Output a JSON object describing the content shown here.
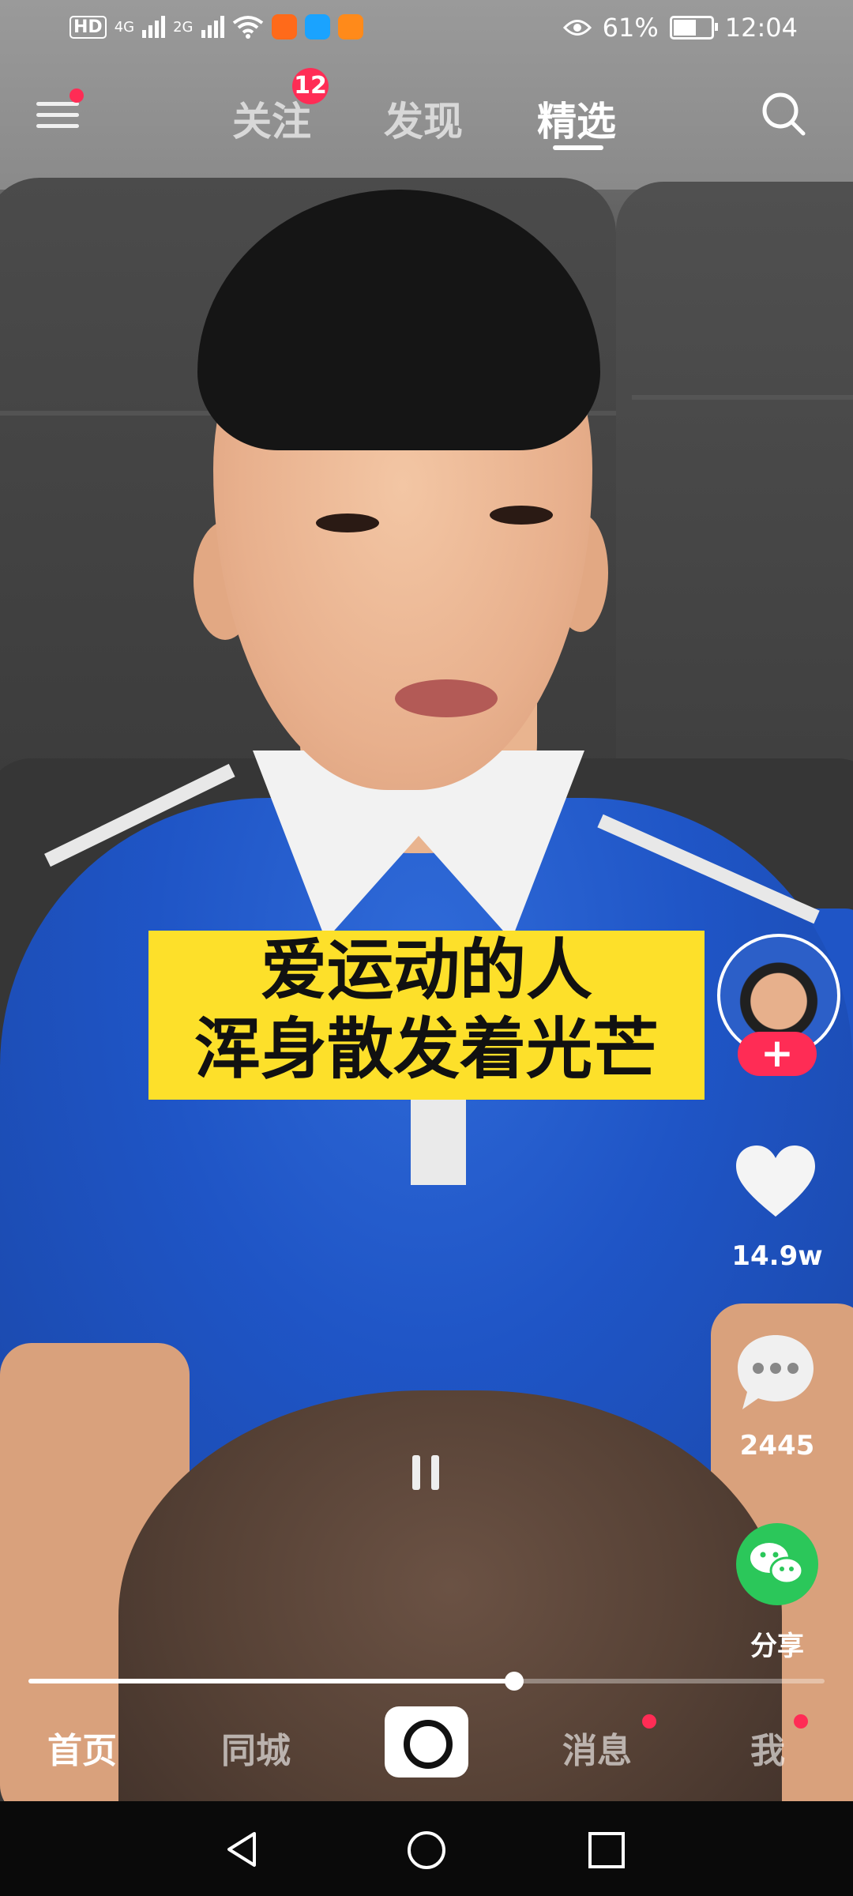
{
  "status_bar": {
    "indicators": [
      "HD",
      "4G",
      "2G"
    ],
    "eye_icon": "eye-icon",
    "battery_percent": "61%",
    "time": "12:04"
  },
  "top_nav": {
    "tabs": [
      {
        "label": "关注",
        "badge": "12"
      },
      {
        "label": "发现"
      },
      {
        "label": "精选",
        "active": true
      }
    ]
  },
  "caption": {
    "line1": "爱运动的人",
    "line2": "浑身散发着光芒"
  },
  "actions": {
    "follow_symbol": "+",
    "likes": "14.9w",
    "comments": "2445",
    "share_label": "分享"
  },
  "playback": {
    "progress_fraction": 0.61
  },
  "bottom_tabs": [
    {
      "label": "首页",
      "active": true
    },
    {
      "label": "同城"
    },
    {
      "label": "消息",
      "dot": true
    },
    {
      "label": "我",
      "dot": true
    }
  ],
  "colors": {
    "accent": "#ff2c55",
    "caption_bg": "#fde02a",
    "share_green": "#2bc75a"
  }
}
